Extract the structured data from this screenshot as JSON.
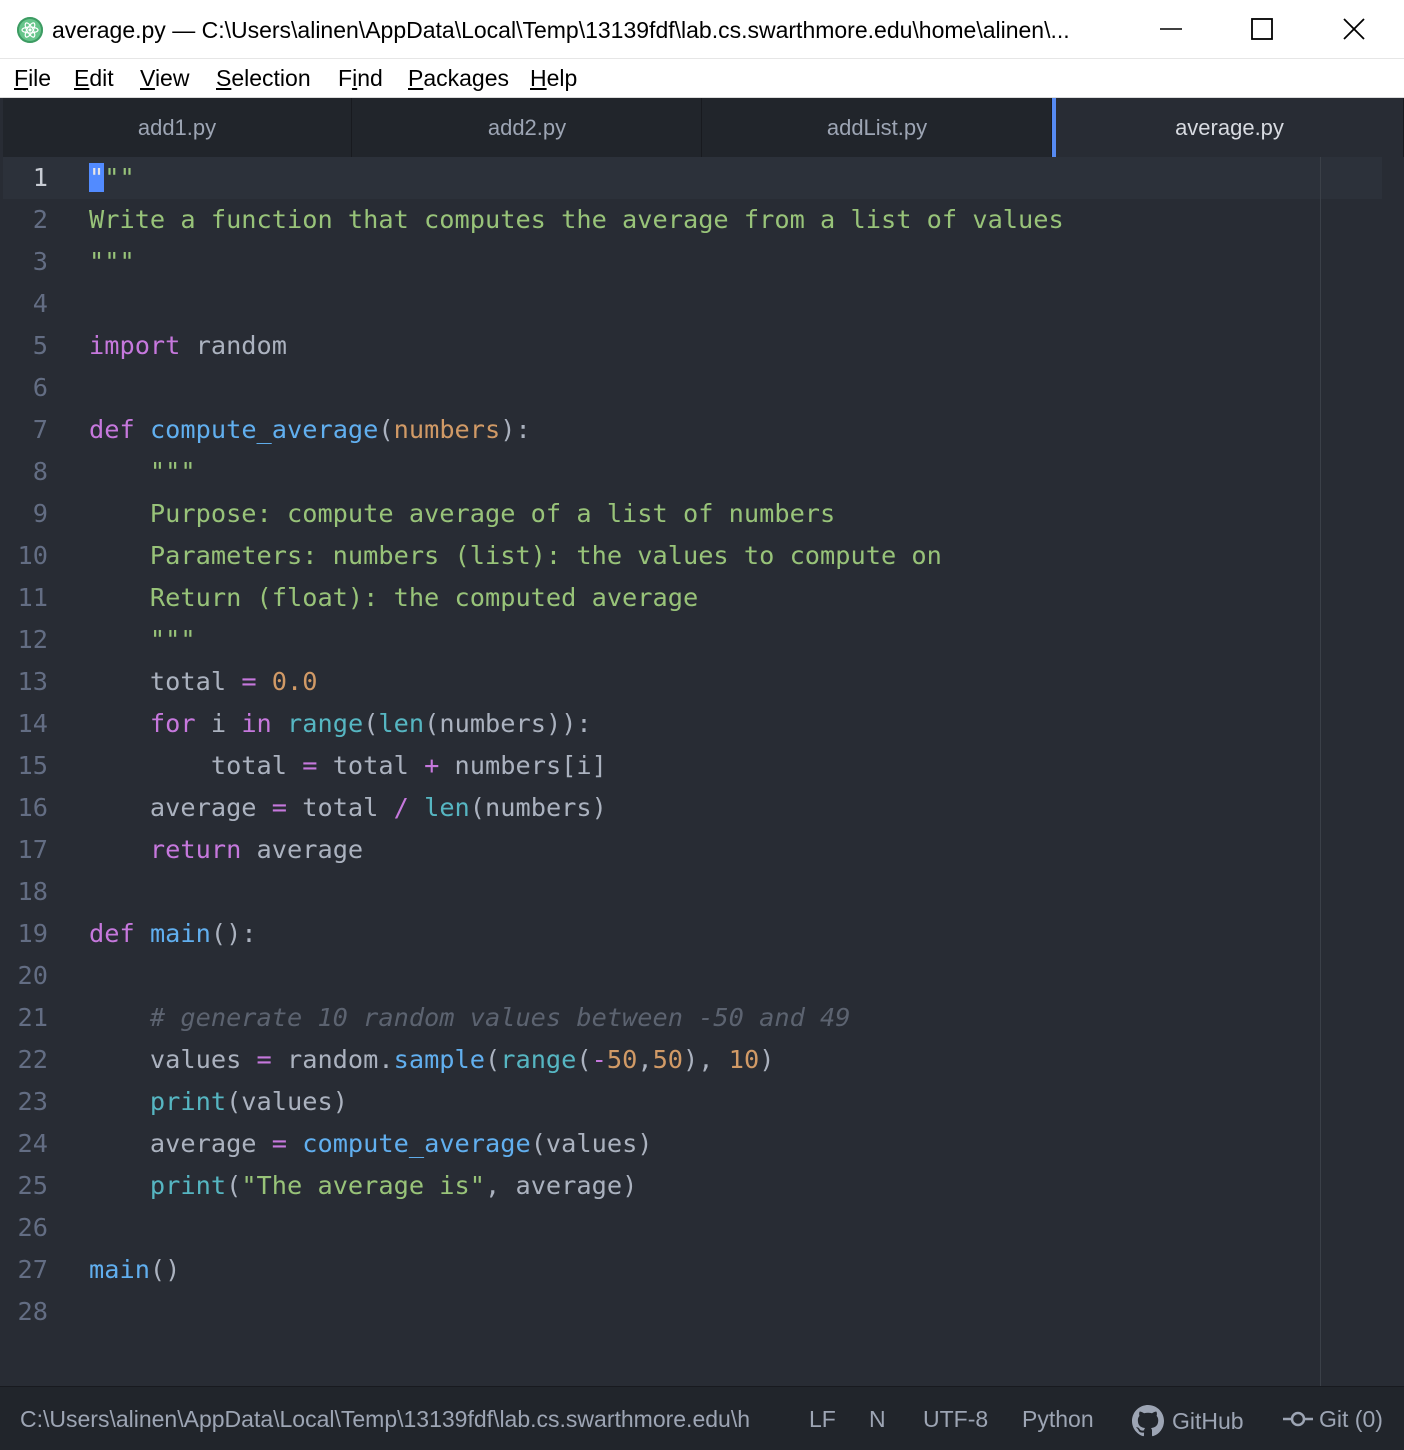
{
  "window": {
    "title": "average.py — C:\\Users\\alinen\\AppData\\Local\\Temp\\13139fdf\\lab.cs.swarthmore.edu\\home\\alinen\\...",
    "minimize_icon": "minimize-icon",
    "maximize_icon": "maximize-icon",
    "close_icon": "close-icon",
    "app_icon": "atom-logo-icon"
  },
  "menu": {
    "items": [
      {
        "acc": "F",
        "rest": "ile"
      },
      {
        "acc": "E",
        "rest": "dit"
      },
      {
        "acc": "V",
        "rest": "iew"
      },
      {
        "acc": "S",
        "rest": "election"
      },
      {
        "pre": "F",
        "acc": "i",
        "rest": "nd"
      },
      {
        "acc": "P",
        "rest": "ackages"
      },
      {
        "acc": "H",
        "rest": "elp"
      }
    ]
  },
  "tabs": [
    {
      "label": "add1.py"
    },
    {
      "label": "add2.py"
    },
    {
      "label": "addList.py"
    },
    {
      "label": "average.py",
      "active": true
    }
  ],
  "editor": {
    "line_numbers": [
      "1",
      "2",
      "3",
      "4",
      "5",
      "6",
      "7",
      "8",
      "9",
      "10",
      "11",
      "12",
      "13",
      "14",
      "15",
      "16",
      "17",
      "18",
      "19",
      "20",
      "21",
      "22",
      "23",
      "24",
      "25",
      "26",
      "27",
      "28"
    ],
    "lines": [
      [
        [
          "cursor",
          "\""
        ],
        [
          "str",
          "\"\""
        ]
      ],
      [
        [
          "str",
          "Write a function that computes the average from a list of values"
        ]
      ],
      [
        [
          "str",
          "\"\"\""
        ]
      ],
      [],
      [
        [
          "kw",
          "import"
        ],
        [
          "plain",
          " random"
        ]
      ],
      [],
      [
        [
          "kw",
          "def"
        ],
        [
          "plain",
          " "
        ],
        [
          "fn",
          "compute_average"
        ],
        [
          "plain",
          "("
        ],
        [
          "param",
          "numbers"
        ],
        [
          "plain",
          "):"
        ]
      ],
      [
        [
          "plain",
          "    "
        ],
        [
          "str",
          "\"\"\""
        ]
      ],
      [
        [
          "plain",
          "    "
        ],
        [
          "str",
          "Purpose: compute average of a list of numbers"
        ]
      ],
      [
        [
          "plain",
          "    "
        ],
        [
          "str",
          "Parameters: numbers (list): the values to compute on"
        ]
      ],
      [
        [
          "plain",
          "    "
        ],
        [
          "str",
          "Return (float): the computed average"
        ]
      ],
      [
        [
          "plain",
          "    "
        ],
        [
          "str",
          "\"\"\""
        ]
      ],
      [
        [
          "plain",
          "    total "
        ],
        [
          "op",
          "="
        ],
        [
          "plain",
          " "
        ],
        [
          "num",
          "0.0"
        ]
      ],
      [
        [
          "plain",
          "    "
        ],
        [
          "kw",
          "for"
        ],
        [
          "plain",
          " i "
        ],
        [
          "kw",
          "in"
        ],
        [
          "plain",
          " "
        ],
        [
          "bi",
          "range"
        ],
        [
          "plain",
          "("
        ],
        [
          "bi",
          "len"
        ],
        [
          "plain",
          "(numbers)):"
        ]
      ],
      [
        [
          "plain",
          "        total "
        ],
        [
          "op",
          "="
        ],
        [
          "plain",
          " total "
        ],
        [
          "op",
          "+"
        ],
        [
          "plain",
          " numbers[i]"
        ]
      ],
      [
        [
          "plain",
          "    average "
        ],
        [
          "op",
          "="
        ],
        [
          "plain",
          " total "
        ],
        [
          "op",
          "/"
        ],
        [
          "plain",
          " "
        ],
        [
          "bi",
          "len"
        ],
        [
          "plain",
          "(numbers)"
        ]
      ],
      [
        [
          "plain",
          "    "
        ],
        [
          "kw",
          "return"
        ],
        [
          "plain",
          " average"
        ]
      ],
      [],
      [
        [
          "kw",
          "def"
        ],
        [
          "plain",
          " "
        ],
        [
          "fn",
          "main"
        ],
        [
          "plain",
          "():"
        ]
      ],
      [],
      [
        [
          "plain",
          "    "
        ],
        [
          "cm",
          "# generate 10 random values between -50 and 49"
        ]
      ],
      [
        [
          "plain",
          "    values "
        ],
        [
          "op",
          "="
        ],
        [
          "plain",
          " random."
        ],
        [
          "fn",
          "sample"
        ],
        [
          "plain",
          "("
        ],
        [
          "bi",
          "range"
        ],
        [
          "plain",
          "("
        ],
        [
          "op",
          "-"
        ],
        [
          "num",
          "50"
        ],
        [
          "plain",
          ","
        ],
        [
          "num",
          "50"
        ],
        [
          "plain",
          "), "
        ],
        [
          "num",
          "10"
        ],
        [
          "plain",
          ")"
        ]
      ],
      [
        [
          "plain",
          "    "
        ],
        [
          "bi",
          "print"
        ],
        [
          "plain",
          "(values)"
        ]
      ],
      [
        [
          "plain",
          "    average "
        ],
        [
          "op",
          "="
        ],
        [
          "plain",
          " "
        ],
        [
          "fn",
          "compute_average"
        ],
        [
          "plain",
          "(values)"
        ]
      ],
      [
        [
          "plain",
          "    "
        ],
        [
          "bi",
          "print"
        ],
        [
          "plain",
          "("
        ],
        [
          "str",
          "\"The average is\""
        ],
        [
          "plain",
          ", average)"
        ]
      ],
      [],
      [
        [
          "fn",
          "main"
        ],
        [
          "plain",
          "()"
        ]
      ],
      []
    ]
  },
  "status": {
    "path": "C:\\Users\\alinen\\AppData\\Local\\Temp\\13139fdf\\lab.cs.swarthmore.edu\\h",
    "line_ending": "LF",
    "indent": "N",
    "encoding": "UTF-8",
    "grammar": "Python",
    "github": "GitHub",
    "github_icon": "github-icon",
    "git": "Git (0)",
    "git_icon": "git-commit-icon"
  },
  "colors": {
    "editor_bg": "#282c34",
    "accent": "#568af2",
    "string": "#98c379",
    "keyword": "#c678dd",
    "function": "#61afef"
  }
}
